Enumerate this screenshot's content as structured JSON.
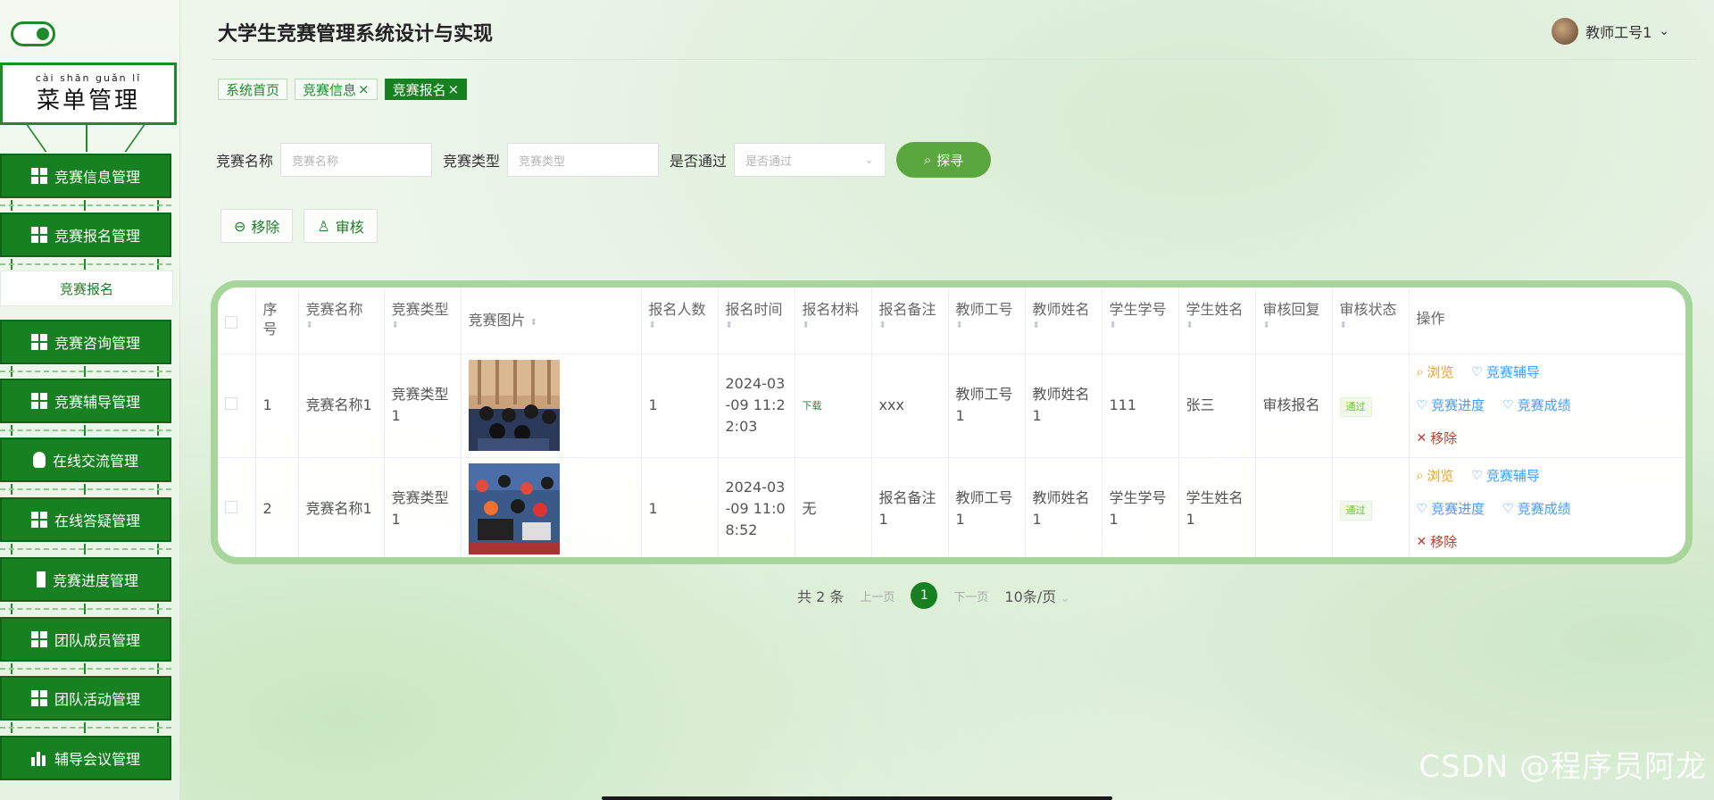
{
  "app": {
    "title": "大学生竞赛管理系统设计与实现",
    "user": "教师工号1",
    "user_caret": "⌄"
  },
  "menu": {
    "title_pinyin": "cài shān guǎn lǐ",
    "title": "菜单管理",
    "items": [
      {
        "label": "竞赛信息管理",
        "icon": "grid-icon"
      },
      {
        "label": "竞赛报名管理",
        "icon": "grid-icon"
      },
      {
        "label": "竞赛咨询管理",
        "icon": "grid-icon"
      },
      {
        "label": "竞赛辅导管理",
        "icon": "grid-icon"
      },
      {
        "label": "在线交流管理",
        "icon": "bulb-icon"
      },
      {
        "label": "在线答疑管理",
        "icon": "grid-icon"
      },
      {
        "label": "竞赛进度管理",
        "icon": "book-icon"
      },
      {
        "label": "团队成员管理",
        "icon": "grid-icon"
      },
      {
        "label": "团队活动管理",
        "icon": "grid-icon"
      },
      {
        "label": "辅导会议管理",
        "icon": "bar-chart-icon"
      }
    ],
    "sub_item": "竞赛报名"
  },
  "tabs": [
    {
      "label": "系统首页",
      "closable": false
    },
    {
      "label": "竞赛信息",
      "closable": true
    },
    {
      "label": "竞赛报名",
      "closable": true,
      "active": true
    }
  ],
  "tab_close": "×",
  "search": {
    "name_label": "竞赛名称",
    "name_placeholder": "竞赛名称",
    "type_label": "竞赛类型",
    "type_placeholder": "竞赛类型",
    "pass_label": "是否通过",
    "pass_placeholder": "是否通过",
    "button": "探寻"
  },
  "actions": {
    "remove": "移除",
    "review": "审核"
  },
  "table": {
    "headers": [
      "序号",
      "竞赛名称",
      "竞赛类型",
      "竞赛图片",
      "报名人数",
      "报名时间",
      "报名材料",
      "报名备注",
      "教师工号",
      "教师姓名",
      "学生学号",
      "学生姓名",
      "审核回复",
      "审核状态",
      "操作"
    ],
    "rows": [
      {
        "index": "1",
        "name": "竞赛名称1",
        "type": "竞赛类型1",
        "count": "1",
        "time": "2024-03-09 11:22:03",
        "material": "下载",
        "note": "xxx",
        "teacher_no": "教师工号1",
        "teacher_name": "教师姓名1",
        "student_no": "111",
        "student_name": "张三",
        "reply": "审核报名",
        "status": "通过"
      },
      {
        "index": "2",
        "name": "竞赛名称1",
        "type": "竞赛类型1",
        "count": "1",
        "time": "2024-03-09 11:08:52",
        "material": "无",
        "note": "报名备注1",
        "teacher_no": "教师工号1",
        "teacher_name": "教师姓名1",
        "student_no": "学生学号1",
        "student_name": "学生姓名1",
        "reply": "",
        "status": "通过"
      }
    ],
    "ops": {
      "view": "浏览",
      "coach": "竞赛辅导",
      "progress": "竞赛进度",
      "result": "竞赛成绩",
      "remove": "移除"
    }
  },
  "pager": {
    "total": "共 2 条",
    "prev": "上一页",
    "current": "1",
    "next": "下一页",
    "size": "10条/页"
  },
  "watermark": "CSDN @程序员阿龙",
  "colors": {
    "primary": "#178021",
    "accent": "#5aa63f",
    "view": "#f0a020",
    "link": "#409eff",
    "danger": "#c0392b"
  }
}
